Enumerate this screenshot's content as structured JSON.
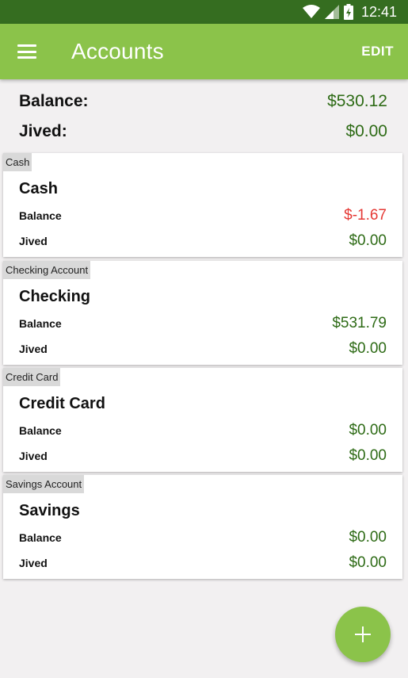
{
  "status_bar": {
    "time": "12:41"
  },
  "app_bar": {
    "title": "Accounts",
    "edit_label": "EDIT"
  },
  "summary": {
    "balance_label": "Balance:",
    "balance_value": "$530.12",
    "jived_label": "Jived:",
    "jived_value": "$0.00"
  },
  "accounts": [
    {
      "type": "Cash",
      "name": "Cash",
      "balance_label": "Balance",
      "balance": "$-1.67",
      "jived_label": "Jived",
      "jived": "$0.00"
    },
    {
      "type": "Checking Account",
      "name": "Checking",
      "balance_label": "Balance",
      "balance": "$531.79",
      "jived_label": "Jived",
      "jived": "$0.00"
    },
    {
      "type": "Credit Card",
      "name": "Credit Card",
      "balance_label": "Balance",
      "balance": "$0.00",
      "jived_label": "Jived",
      "jived": "$0.00"
    },
    {
      "type": "Savings Account",
      "name": "Savings",
      "balance_label": "Balance",
      "balance": "$0.00",
      "jived_label": "Jived",
      "jived": "$0.00"
    }
  ],
  "colors": {
    "status_bar": "#356d20",
    "app_bar": "#8bc34a",
    "positive_amount": "#2e6b16",
    "negative_amount": "#e53935"
  },
  "icons": [
    "wifi-icon",
    "cell-signal-icon",
    "battery-charging-icon",
    "menu-icon",
    "add-icon"
  ]
}
